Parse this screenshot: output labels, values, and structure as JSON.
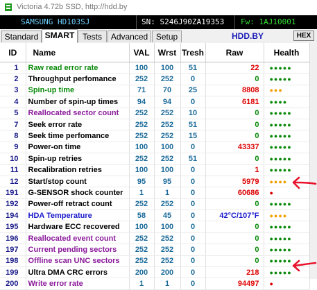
{
  "window": {
    "title": "Victoria 4.72b SSD, http://hdd.by"
  },
  "info": {
    "model": "SAMSUNG HD103SJ",
    "serial": "SN: S246J90ZA19353",
    "firmware": "Fw: 1AJ10001"
  },
  "tabs": [
    {
      "label": "Standard",
      "active": false
    },
    {
      "label": "SMART",
      "active": true
    },
    {
      "label": "Tests",
      "active": false
    },
    {
      "label": "Advanced",
      "active": false
    },
    {
      "label": "Setup",
      "active": false
    }
  ],
  "brand": "HDD.BY",
  "hex_button": "HEX",
  "columns": [
    "ID",
    "Name",
    "VAL",
    "Wrst",
    "Tresh",
    "Raw",
    "Health"
  ],
  "colors": {
    "green": "#0a8a0a",
    "purple": "#8a1a9a",
    "black": "#000000",
    "blue": "#1a1acc",
    "red": "#dd0000",
    "orange": "#f0a000"
  },
  "rows": [
    {
      "id": "1",
      "name": "Raw read error rate",
      "val": "100",
      "wrst": "100",
      "tresh": "51",
      "raw": "22",
      "health": "●●●●●",
      "name_color": "green",
      "raw_color": "red",
      "health_color": "green"
    },
    {
      "id": "2",
      "name": "Throughput perfomance",
      "val": "252",
      "wrst": "252",
      "tresh": "0",
      "raw": "0",
      "health": "●●●●●",
      "name_color": "black",
      "raw_color": "green",
      "health_color": "green"
    },
    {
      "id": "3",
      "name": "Spin-up time",
      "val": "71",
      "wrst": "70",
      "tresh": "25",
      "raw": "8808",
      "health": "●●●",
      "name_color": "green",
      "raw_color": "red",
      "health_color": "orange"
    },
    {
      "id": "4",
      "name": "Number of spin-up times",
      "val": "94",
      "wrst": "94",
      "tresh": "0",
      "raw": "6181",
      "health": "●●●●",
      "name_color": "black",
      "raw_color": "red",
      "health_color": "green"
    },
    {
      "id": "5",
      "name": "Reallocated sector count",
      "val": "252",
      "wrst": "252",
      "tresh": "10",
      "raw": "0",
      "health": "●●●●●",
      "name_color": "purple",
      "raw_color": "green",
      "health_color": "green"
    },
    {
      "id": "7",
      "name": "Seek error rate",
      "val": "252",
      "wrst": "252",
      "tresh": "51",
      "raw": "0",
      "health": "●●●●●",
      "name_color": "black",
      "raw_color": "green",
      "health_color": "green"
    },
    {
      "id": "8",
      "name": "Seek time perfomance",
      "val": "252",
      "wrst": "252",
      "tresh": "15",
      "raw": "0",
      "health": "●●●●●",
      "name_color": "black",
      "raw_color": "green",
      "health_color": "green"
    },
    {
      "id": "9",
      "name": "Power-on time",
      "val": "100",
      "wrst": "100",
      "tresh": "0",
      "raw": "43337",
      "health": "●●●●●",
      "name_color": "black",
      "raw_color": "red",
      "health_color": "green"
    },
    {
      "id": "10",
      "name": "Spin-up retries",
      "val": "252",
      "wrst": "252",
      "tresh": "51",
      "raw": "0",
      "health": "●●●●●",
      "name_color": "black",
      "raw_color": "green",
      "health_color": "green"
    },
    {
      "id": "11",
      "name": "Recalibration retries",
      "val": "100",
      "wrst": "100",
      "tresh": "0",
      "raw": "1",
      "health": "●●●●●",
      "name_color": "black",
      "raw_color": "red",
      "health_color": "green"
    },
    {
      "id": "12",
      "name": "Start/stop count",
      "val": "95",
      "wrst": "95",
      "tresh": "0",
      "raw": "5979",
      "health": "●●●●",
      "name_color": "black",
      "raw_color": "red",
      "health_color": "orange"
    },
    {
      "id": "191",
      "name": "G-SENSOR shock counter",
      "val": "1",
      "wrst": "1",
      "tresh": "0",
      "raw": "60686",
      "health": "●",
      "name_color": "black",
      "raw_color": "red",
      "health_color": "red"
    },
    {
      "id": "192",
      "name": "Power-off retract count",
      "val": "252",
      "wrst": "252",
      "tresh": "0",
      "raw": "0",
      "health": "●●●●●",
      "name_color": "black",
      "raw_color": "green",
      "health_color": "green"
    },
    {
      "id": "194",
      "name": "HDA Temperature",
      "val": "58",
      "wrst": "45",
      "tresh": "0",
      "raw": "42°C/107°F",
      "health": "●●●●",
      "name_color": "blue",
      "raw_color": "blue",
      "health_color": "orange"
    },
    {
      "id": "195",
      "name": "Hardware ECC recovered",
      "val": "100",
      "wrst": "100",
      "tresh": "0",
      "raw": "0",
      "health": "●●●●●",
      "name_color": "black",
      "raw_color": "green",
      "health_color": "green"
    },
    {
      "id": "196",
      "name": "Reallocated event count",
      "val": "252",
      "wrst": "252",
      "tresh": "0",
      "raw": "0",
      "health": "●●●●●",
      "name_color": "purple",
      "raw_color": "green",
      "health_color": "green"
    },
    {
      "id": "197",
      "name": "Current pending sectors",
      "val": "252",
      "wrst": "252",
      "tresh": "0",
      "raw": "0",
      "health": "●●●●●",
      "name_color": "purple",
      "raw_color": "green",
      "health_color": "green"
    },
    {
      "id": "198",
      "name": "Offline scan UNC sectors",
      "val": "252",
      "wrst": "252",
      "tresh": "0",
      "raw": "0",
      "health": "●●●●●",
      "name_color": "purple",
      "raw_color": "green",
      "health_color": "green"
    },
    {
      "id": "199",
      "name": "Ultra DMA CRC errors",
      "val": "200",
      "wrst": "200",
      "tresh": "0",
      "raw": "218",
      "health": "●●●●●",
      "name_color": "black",
      "raw_color": "red",
      "health_color": "green"
    },
    {
      "id": "200",
      "name": "Write error rate",
      "val": "1",
      "wrst": "1",
      "tresh": "0",
      "raw": "94497",
      "health": "●",
      "name_color": "purple",
      "raw_color": "red",
      "health_color": "red"
    }
  ]
}
